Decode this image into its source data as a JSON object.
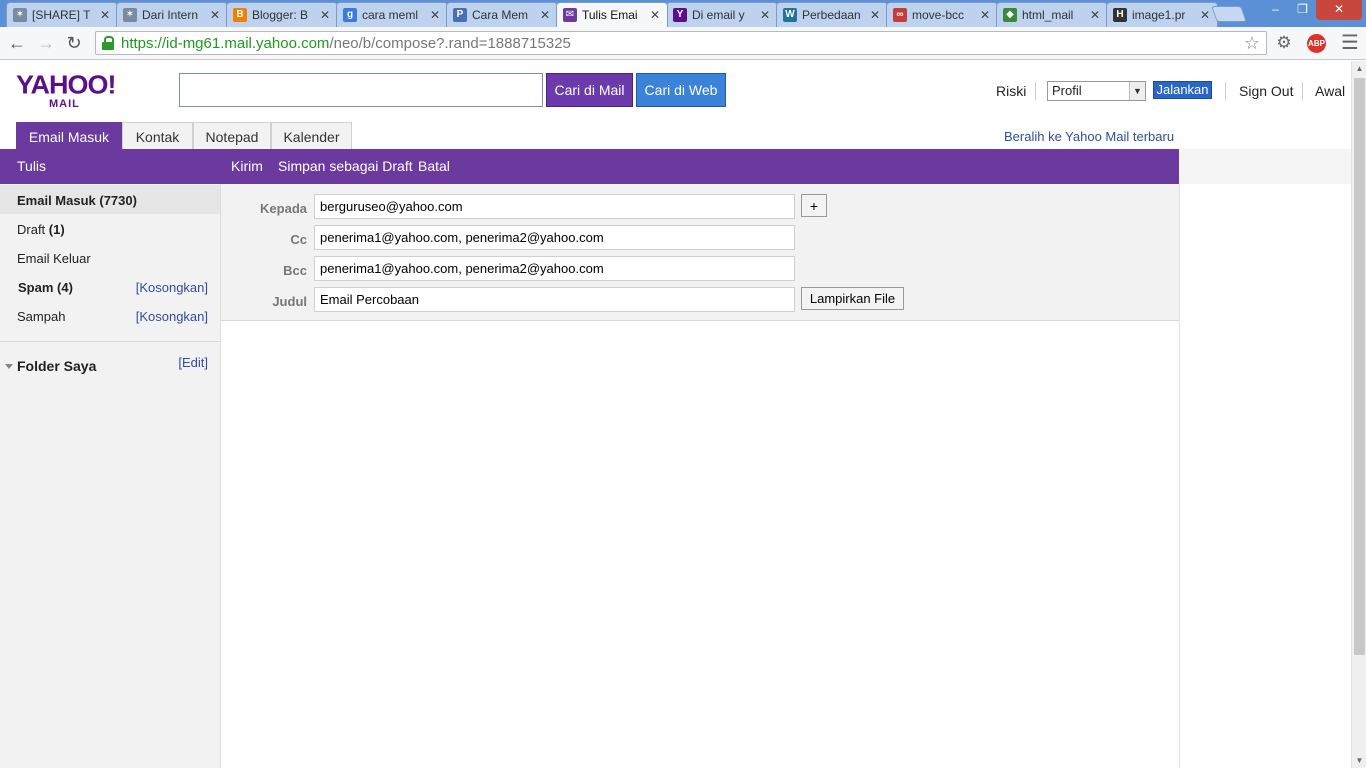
{
  "browser": {
    "tabs": [
      {
        "title": "[SHARE] T",
        "favicon": "paw-icon",
        "color": "#7a8aa0"
      },
      {
        "title": "Dari Intern",
        "favicon": "paw-icon",
        "color": "#7a8aa0"
      },
      {
        "title": "Blogger: B",
        "favicon": "blogger-icon",
        "color": "#f57d00"
      },
      {
        "title": "cara meml",
        "favicon": "google-icon",
        "color": "#3b7bdc"
      },
      {
        "title": "Cara Mem",
        "favicon": "page-icon",
        "color": "#4b6fb5"
      },
      {
        "title": "Tulis Emai",
        "favicon": "mail-icon",
        "color": "#6b3a9f"
      },
      {
        "title": "Di email y",
        "favicon": "yahoo-icon",
        "color": "#5c0f8b"
      },
      {
        "title": "Perbedaan",
        "favicon": "wordpress-icon",
        "color": "#21759b"
      },
      {
        "title": "move-bcc",
        "favicon": "link-icon",
        "color": "#c73b3b"
      },
      {
        "title": "html_mail",
        "favicon": "shield-icon",
        "color": "#3a8a3a"
      },
      {
        "title": "image1.pr",
        "favicon": "htg-icon",
        "color": "#333333"
      }
    ],
    "url_host": "https://id-mg61.mail.yahoo.com",
    "url_path": "/neo/b/compose?.rand=1888715325"
  },
  "header": {
    "logo_main": "YAHOO!",
    "logo_sub": "MAIL",
    "search_placeholder": "",
    "search_mail_label": "Cari di Mail",
    "search_web_label": "Cari di Web",
    "user_name": "Riski",
    "profile_select": "Profil",
    "go_label": "Jalankan",
    "sign_out": "Sign Out",
    "home": "Awal"
  },
  "nav": {
    "tabs": [
      "Email Masuk",
      "Kontak",
      "Notepad",
      "Kalender"
    ],
    "new_mail_link": "Beralih ke Yahoo Mail terbaru"
  },
  "actions": {
    "compose": "Tulis",
    "send": "Kirim",
    "save_draft": "Simpan sebagai Draft",
    "cancel": "Batal"
  },
  "sidebar": {
    "inbox": "Email Masuk (7730)",
    "draft_name": "Draft",
    "draft_count": "(1)",
    "sent": "Email Keluar",
    "spam": "Spam (4)",
    "spam_action": "[Kosongkan]",
    "trash": "Sampah",
    "trash_action": "[Kosongkan]",
    "my_folders": "Folder Saya",
    "edit": "[Edit]"
  },
  "compose": {
    "to_label": "Kepada",
    "to_value": "berguruseo@yahoo.com",
    "add_button": "+",
    "cc_label": "Cc",
    "cc_value": "penerima1@yahoo.com, penerima2@yahoo.com",
    "bcc_label": "Bcc",
    "bcc_value": "penerima1@yahoo.com, penerima2@yahoo.com",
    "subject_label": "Judul",
    "subject_value": "Email Percobaan",
    "attach_button": "Lampirkan File"
  },
  "colors": {
    "yahoo_purple": "#6b3a9f",
    "logo_purple": "#5c0f8b",
    "web_blue": "#3b83d9",
    "link_blue": "#2e4e9c"
  }
}
